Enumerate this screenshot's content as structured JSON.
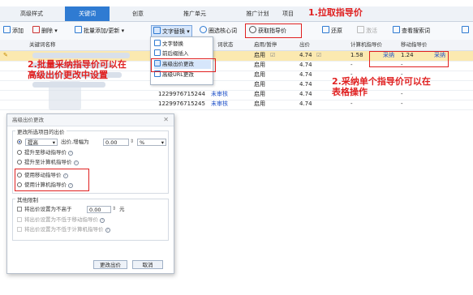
{
  "tabs": [
    {
      "label": "高级样式"
    },
    {
      "label": "关键词"
    },
    {
      "label": "创意"
    },
    {
      "label": "推广单元"
    },
    {
      "label": "推广计划"
    },
    {
      "label": "项目"
    }
  ],
  "toolbar": {
    "add": "添加",
    "delete": "删除",
    "batch_add_update": "批量添加/更新",
    "text_replace": "文字替换",
    "core_words": "圈选核心词",
    "get_guide_price": "获取指导价",
    "restore": "还原",
    "activate": "激活",
    "view_search_terms": "查看搜索词"
  },
  "text_menu": {
    "items": [
      {
        "label": "文字替换"
      },
      {
        "label": "前后缀插入"
      },
      {
        "label": "高级出价更改"
      },
      {
        "label": "高级URL更改"
      }
    ]
  },
  "table": {
    "headers": {
      "keyword": "关键词名称",
      "status": "词状态",
      "enable": "启用/暂停",
      "bid": "出价",
      "pc_guide": "计算机指导价",
      "mobile_guide": "移动指导价"
    },
    "rows": [
      {
        "id": "",
        "status": "",
        "enable": "启用",
        "bid": "4.74",
        "pc": "1.58",
        "pc_tag": "采纳",
        "mobile": "1.24",
        "mobile_tag": "采纳"
      },
      {
        "id": "",
        "status": "",
        "enable": "启用",
        "bid": "4.74",
        "pc": "-",
        "pc_tag": "",
        "mobile": "-",
        "mobile_tag": ""
      },
      {
        "id": "",
        "status": "",
        "enable": "启用",
        "bid": "4.74",
        "pc": "-",
        "pc_tag": "",
        "mobile": "-",
        "mobile_tag": ""
      },
      {
        "id": "",
        "status": "",
        "enable": "启用",
        "bid": "4.74",
        "pc": "-",
        "pc_tag": "",
        "mobile": "-",
        "mobile_tag": ""
      },
      {
        "id": "1229976715244",
        "status": "未审核",
        "enable": "启用",
        "bid": "4.74",
        "pc": "-",
        "pc_tag": "",
        "mobile": "-",
        "mobile_tag": ""
      },
      {
        "id": "1229976715245",
        "status": "未审核",
        "enable": "启用",
        "bid": "4.74",
        "pc": "-",
        "pc_tag": "",
        "mobile": "-",
        "mobile_tag": ""
      }
    ]
  },
  "annotations": {
    "step1": "1.拉取指导价",
    "step2_line1": "2.批量采纳指导价可以在",
    "step2_line2": "高级出价更改中设置",
    "step2b_line1": "2.采纳单个指导价可以在",
    "step2b_line2": "表格操作"
  },
  "dialog": {
    "title": "高级出价更改",
    "group_bid": "更改所选项目的出价",
    "mode_select": "提高",
    "increase_label": "出价,增幅为",
    "increase_value": "0.00",
    "unit_select": "%",
    "opt_raise_mobile": "提升至移动指导价",
    "opt_raise_pc": "提升至计算机指导价",
    "opt_use_mobile": "使用移动指导价",
    "opt_use_pc": "使用计算机指导价",
    "group_other": "其他限制",
    "limit_label": "将出价设置为不高于",
    "limit_value": "0.00",
    "limit_unit": "元",
    "limit_mobile": "将出价设置为不低于移动指导价",
    "limit_pc": "将出价设置为不低于计算机指导价",
    "ok": "更改出价",
    "cancel": "取消"
  },
  "colors": {
    "accent": "#2f7bd2",
    "annotation": "#e02020",
    "selected_row": "#fbe9b0"
  }
}
